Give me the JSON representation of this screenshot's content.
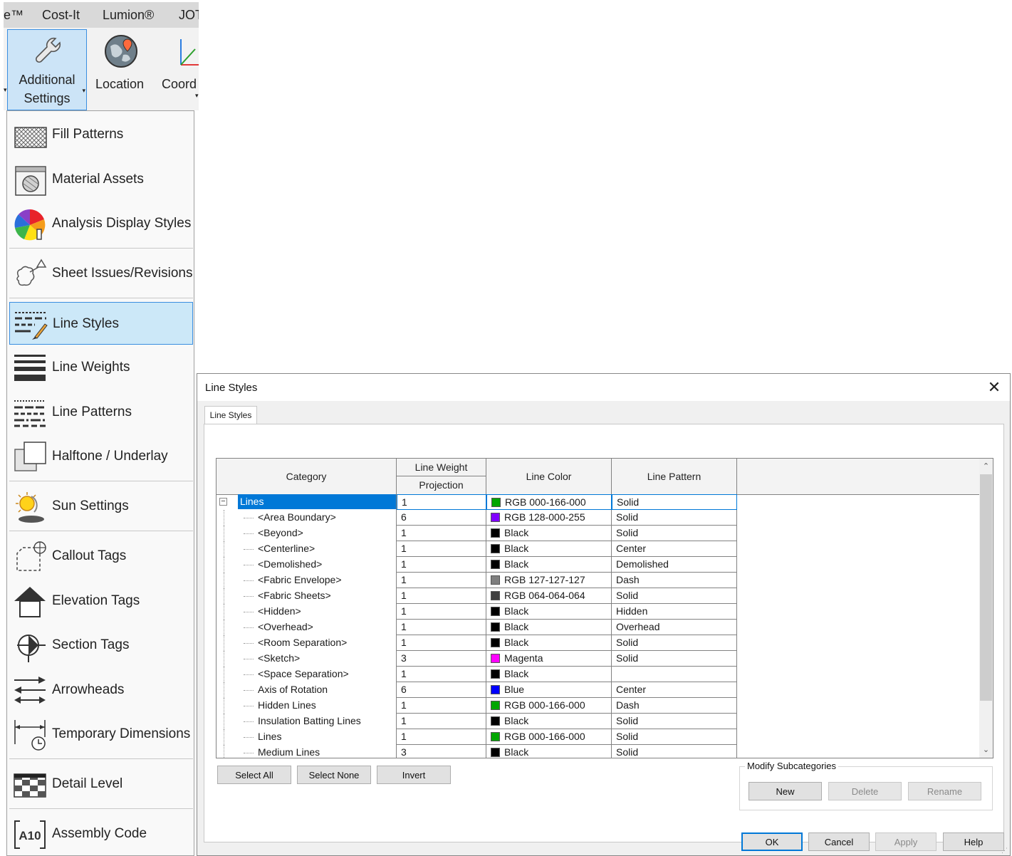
{
  "ribbon": {
    "tabs": [
      "e™",
      "Cost-It",
      "Lumion®",
      "JOT"
    ],
    "buttons": {
      "additional_settings": [
        "Additional",
        "Settings"
      ],
      "location": "Location",
      "coordinates": "Coord"
    }
  },
  "menu": {
    "items": [
      {
        "label": "Fill Patterns",
        "icon": "fill-patterns-icon"
      },
      {
        "label": "Material Assets",
        "icon": "material-assets-icon"
      },
      {
        "label": "Analysis Display Styles",
        "icon": "analysis-display-styles-icon"
      },
      {
        "label": "Sheet Issues/Revisions",
        "icon": "sheet-issues-revisions-icon"
      },
      {
        "label": "Line Styles",
        "icon": "line-styles-icon",
        "selected": true
      },
      {
        "label": "Line Weights",
        "icon": "line-weights-icon"
      },
      {
        "label": "Line Patterns",
        "icon": "line-patterns-icon"
      },
      {
        "label": "Halftone / Underlay",
        "icon": "halftone-underlay-icon"
      },
      {
        "label": "Sun Settings",
        "icon": "sun-settings-icon"
      },
      {
        "label": "Callout Tags",
        "icon": "callout-tags-icon"
      },
      {
        "label": "Elevation Tags",
        "icon": "elevation-tags-icon"
      },
      {
        "label": "Section Tags",
        "icon": "section-tags-icon"
      },
      {
        "label": "Arrowheads",
        "icon": "arrowheads-icon"
      },
      {
        "label": "Temporary Dimensions",
        "icon": "temporary-dimensions-icon"
      },
      {
        "label": "Detail Level",
        "icon": "detail-level-icon"
      },
      {
        "label": "Assembly Code",
        "icon": "assembly-code-icon"
      }
    ]
  },
  "dialog": {
    "title": "Line Styles",
    "tab": "Line Styles",
    "columns": {
      "category": "Category",
      "line_weight": "Line Weight",
      "projection": "Projection",
      "line_color": "Line Color",
      "line_pattern": "Line Pattern"
    },
    "rows": [
      {
        "category": "Lines",
        "weight": "1",
        "color": "RGB 000-166-000",
        "swatch": "#00a600",
        "pattern": "Solid"
      },
      {
        "category": "<Area Boundary>",
        "weight": "6",
        "color": "RGB 128-000-255",
        "swatch": "#8000ff",
        "pattern": "Solid"
      },
      {
        "category": "<Beyond>",
        "weight": "1",
        "color": "Black",
        "swatch": "#000000",
        "pattern": "Solid"
      },
      {
        "category": "<Centerline>",
        "weight": "1",
        "color": "Black",
        "swatch": "#000000",
        "pattern": "Center"
      },
      {
        "category": "<Demolished>",
        "weight": "1",
        "color": "Black",
        "swatch": "#000000",
        "pattern": "Demolished"
      },
      {
        "category": "<Fabric Envelope>",
        "weight": "1",
        "color": "RGB 127-127-127",
        "swatch": "#7f7f7f",
        "pattern": "Dash"
      },
      {
        "category": "<Fabric Sheets>",
        "weight": "1",
        "color": "RGB 064-064-064",
        "swatch": "#404040",
        "pattern": "Solid"
      },
      {
        "category": "<Hidden>",
        "weight": "1",
        "color": "Black",
        "swatch": "#000000",
        "pattern": "Hidden"
      },
      {
        "category": "<Overhead>",
        "weight": "1",
        "color": "Black",
        "swatch": "#000000",
        "pattern": "Overhead"
      },
      {
        "category": "<Room Separation>",
        "weight": "1",
        "color": "Black",
        "swatch": "#000000",
        "pattern": "Solid"
      },
      {
        "category": "<Sketch>",
        "weight": "3",
        "color": "Magenta",
        "swatch": "#ff00ff",
        "pattern": "Solid"
      },
      {
        "category": "<Space Separation>",
        "weight": "1",
        "color": "Black",
        "swatch": "#000000",
        "pattern": ""
      },
      {
        "category": "Axis of Rotation",
        "weight": "6",
        "color": "Blue",
        "swatch": "#0000ff",
        "pattern": "Center"
      },
      {
        "category": "Hidden Lines",
        "weight": "1",
        "color": "RGB 000-166-000",
        "swatch": "#00a600",
        "pattern": "Dash"
      },
      {
        "category": "Insulation Batting Lines",
        "weight": "1",
        "color": "Black",
        "swatch": "#000000",
        "pattern": "Solid"
      },
      {
        "category": "Lines",
        "weight": "1",
        "color": "RGB 000-166-000",
        "swatch": "#00a600",
        "pattern": "Solid"
      },
      {
        "category": "Medium Lines",
        "weight": "3",
        "color": "Black",
        "swatch": "#000000",
        "pattern": "Solid"
      }
    ],
    "buttons": {
      "select_all": "Select All",
      "select_none": "Select None",
      "invert": "Invert",
      "modify_subcategories": "Modify Subcategories",
      "new": "New",
      "delete": "Delete",
      "rename": "Rename",
      "ok": "OK",
      "cancel": "Cancel",
      "apply": "Apply",
      "help": "Help"
    }
  }
}
